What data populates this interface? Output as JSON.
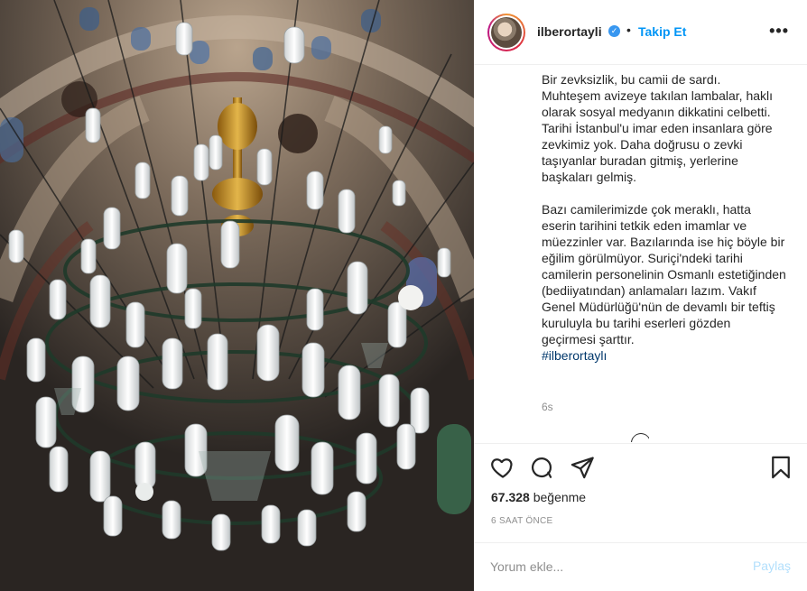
{
  "header": {
    "username": "ilberortayli",
    "verified_mark": "✓",
    "separator": "•",
    "follow_label": "Takip Et",
    "more_label": "•••"
  },
  "caption": {
    "text": "Bir zevksizlik, bu camii de sardı.\nMuhteşem avizeye takılan lambalar, haklı olarak sosyal medyanın dikkatini celbetti. Tarihi İstanbul'u imar eden insanlara göre zevkimiz yok. Daha doğrusu o zevki taşıyanlar buradan gitmiş, yerlerine başkaları gelmiş.\n\nBazı camilerimizde çok meraklı, hatta eserin tarihini tetkik eden imamlar ve müezzinler var. Bazılarında ise hiç böyle bir eğilim görülmüyor. Suriçi'ndeki tarihi camilerin personelinin Osmanlı estetiğinden (bediiyatından) anlamaları lazım. Vakıf Genel Müdürlüğü'nün de devamlı bir teftiş kuruluyla bu tarihi eserleri gözden geçirmesi şarttır.",
    "hashtag": "#ilberortaylı",
    "relative_time": "6s"
  },
  "actions": {
    "like_icon": "heart-icon",
    "comment_icon": "comment-icon",
    "share_icon": "paper-plane-icon",
    "save_icon": "bookmark-icon",
    "likes_count": "67.328",
    "likes_word": " beğenme",
    "post_time": "6 SAAT ÖNCE"
  },
  "comment": {
    "placeholder": "Yorum ekle...",
    "post_label": "Paylaş"
  },
  "colors": {
    "accent": "#0095f6",
    "verified": "#3897f0",
    "post_disabled": "#b2dffc",
    "hashtag": "#00376b"
  }
}
